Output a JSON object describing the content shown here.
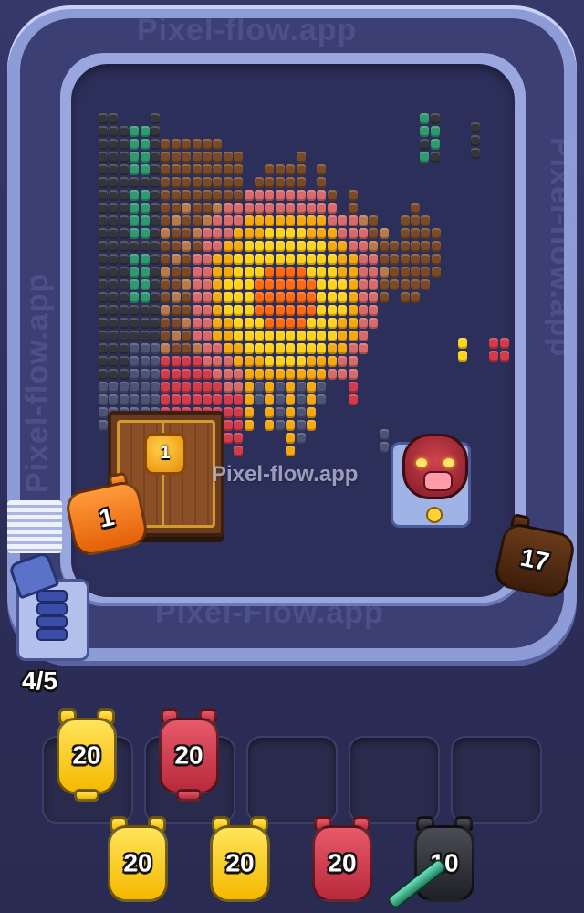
{
  "watermark": "Pixel-flow.app",
  "watermark_bottom": "Pixel-Flow.app",
  "crate": {
    "count": "1"
  },
  "active_cannon": {
    "color": "orange",
    "count": "1"
  },
  "conveyor_cannon": {
    "color": "brown",
    "count": "17"
  },
  "boar_enemy": {
    "color": "#c0323f"
  },
  "queue_counter": "4/5",
  "holding_slots": [
    {
      "color": "yellow",
      "count": "20"
    },
    {
      "color": "red",
      "count": "20"
    },
    {
      "empty": true
    },
    {
      "empty": true
    },
    {
      "empty": true
    }
  ],
  "bottom_queue": [
    {
      "color": "yellow",
      "count": "20"
    },
    {
      "color": "yellow",
      "count": "20"
    },
    {
      "color": "red",
      "count": "20"
    },
    {
      "color": "black",
      "count": "10"
    }
  ],
  "palette": {
    "black": "#34363b",
    "green": "#2f9a6e",
    "brown": "#7a4a26",
    "tan": "#b97a4a",
    "pink": "#d96a6a",
    "red": "#d53a48",
    "yellow": "#ffd319",
    "gold": "#f5a90c",
    "orange": "#ff6a10",
    "slate": "#4d5473"
  }
}
